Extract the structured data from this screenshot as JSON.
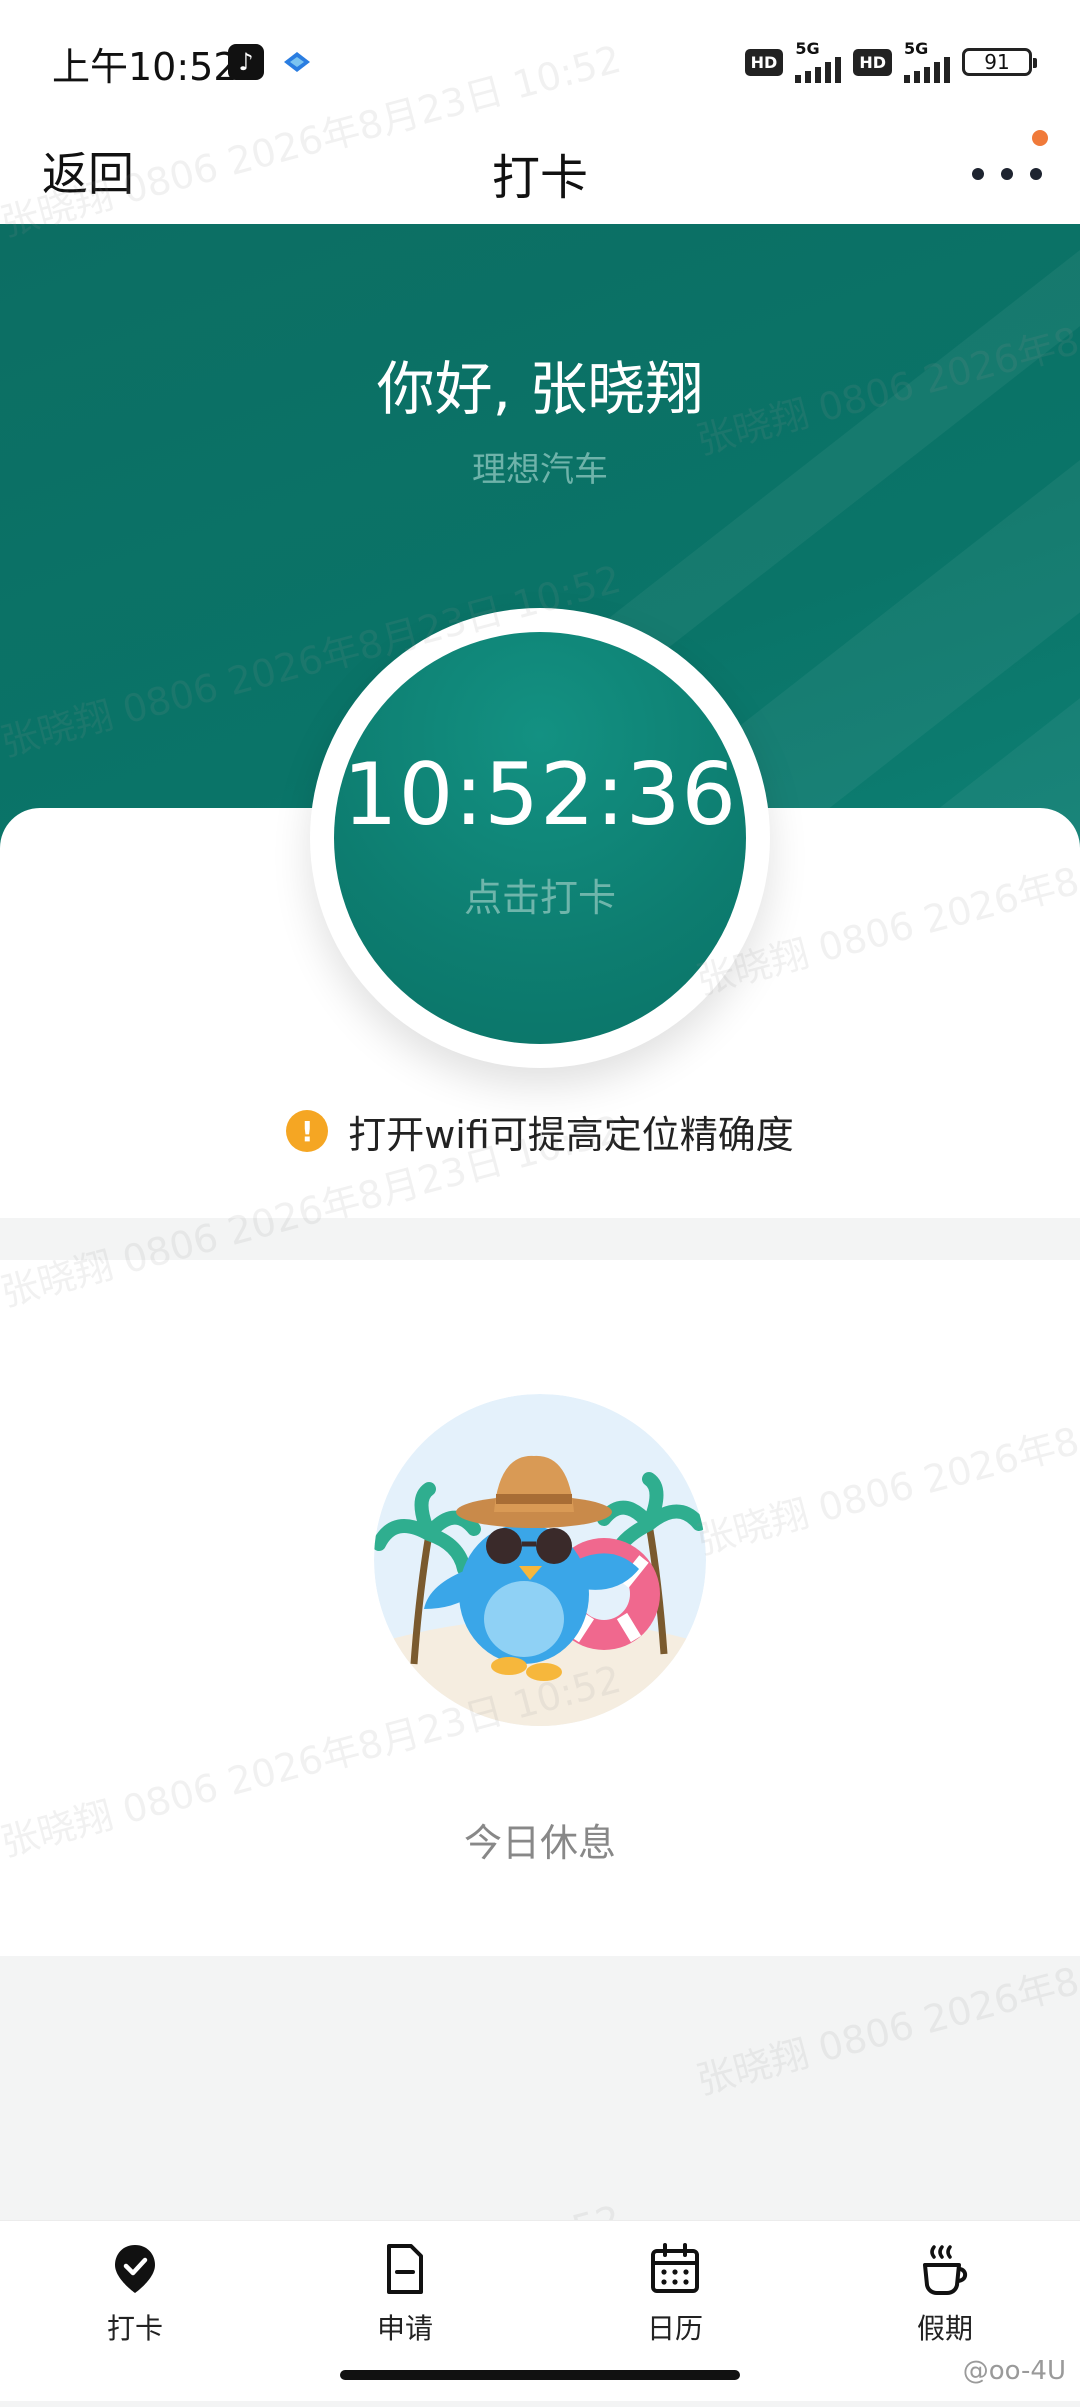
{
  "status_bar": {
    "time": "上午10:52",
    "app_icon": "tiktok-icon",
    "hd1": "HD",
    "net1": "5G",
    "hd2": "HD",
    "net2": "5G",
    "battery": "91"
  },
  "nav": {
    "back": "返回",
    "title": "打卡",
    "more_icon": "more-dots-icon"
  },
  "header": {
    "greeting": "你好, 张晓翔",
    "company": "理想汽车"
  },
  "clock": {
    "time": "10:52:36",
    "action": "点击打卡"
  },
  "tip": {
    "icon": "!",
    "text": "打开wifi可提高定位精确度"
  },
  "rest": {
    "text": "今日休息"
  },
  "tabs": [
    {
      "label": "打卡",
      "icon": "checkin-pin-icon"
    },
    {
      "label": "申请",
      "icon": "document-icon"
    },
    {
      "label": "日历",
      "icon": "calendar-icon"
    },
    {
      "label": "假期",
      "icon": "coffee-cup-icon"
    }
  ],
  "watermark": {
    "a": "张晓翔 0806 2026年8月23日 10:52",
    "b": "0806 2026年8月23日 10:52",
    "c": "张晓翔 0806 2026年8"
  },
  "weibo_handle": "@oo-4U",
  "colors": {
    "brand_teal": "#0c7a6e",
    "notice_orange": "#f07a3a",
    "warning_yellow": "#f5a623"
  }
}
